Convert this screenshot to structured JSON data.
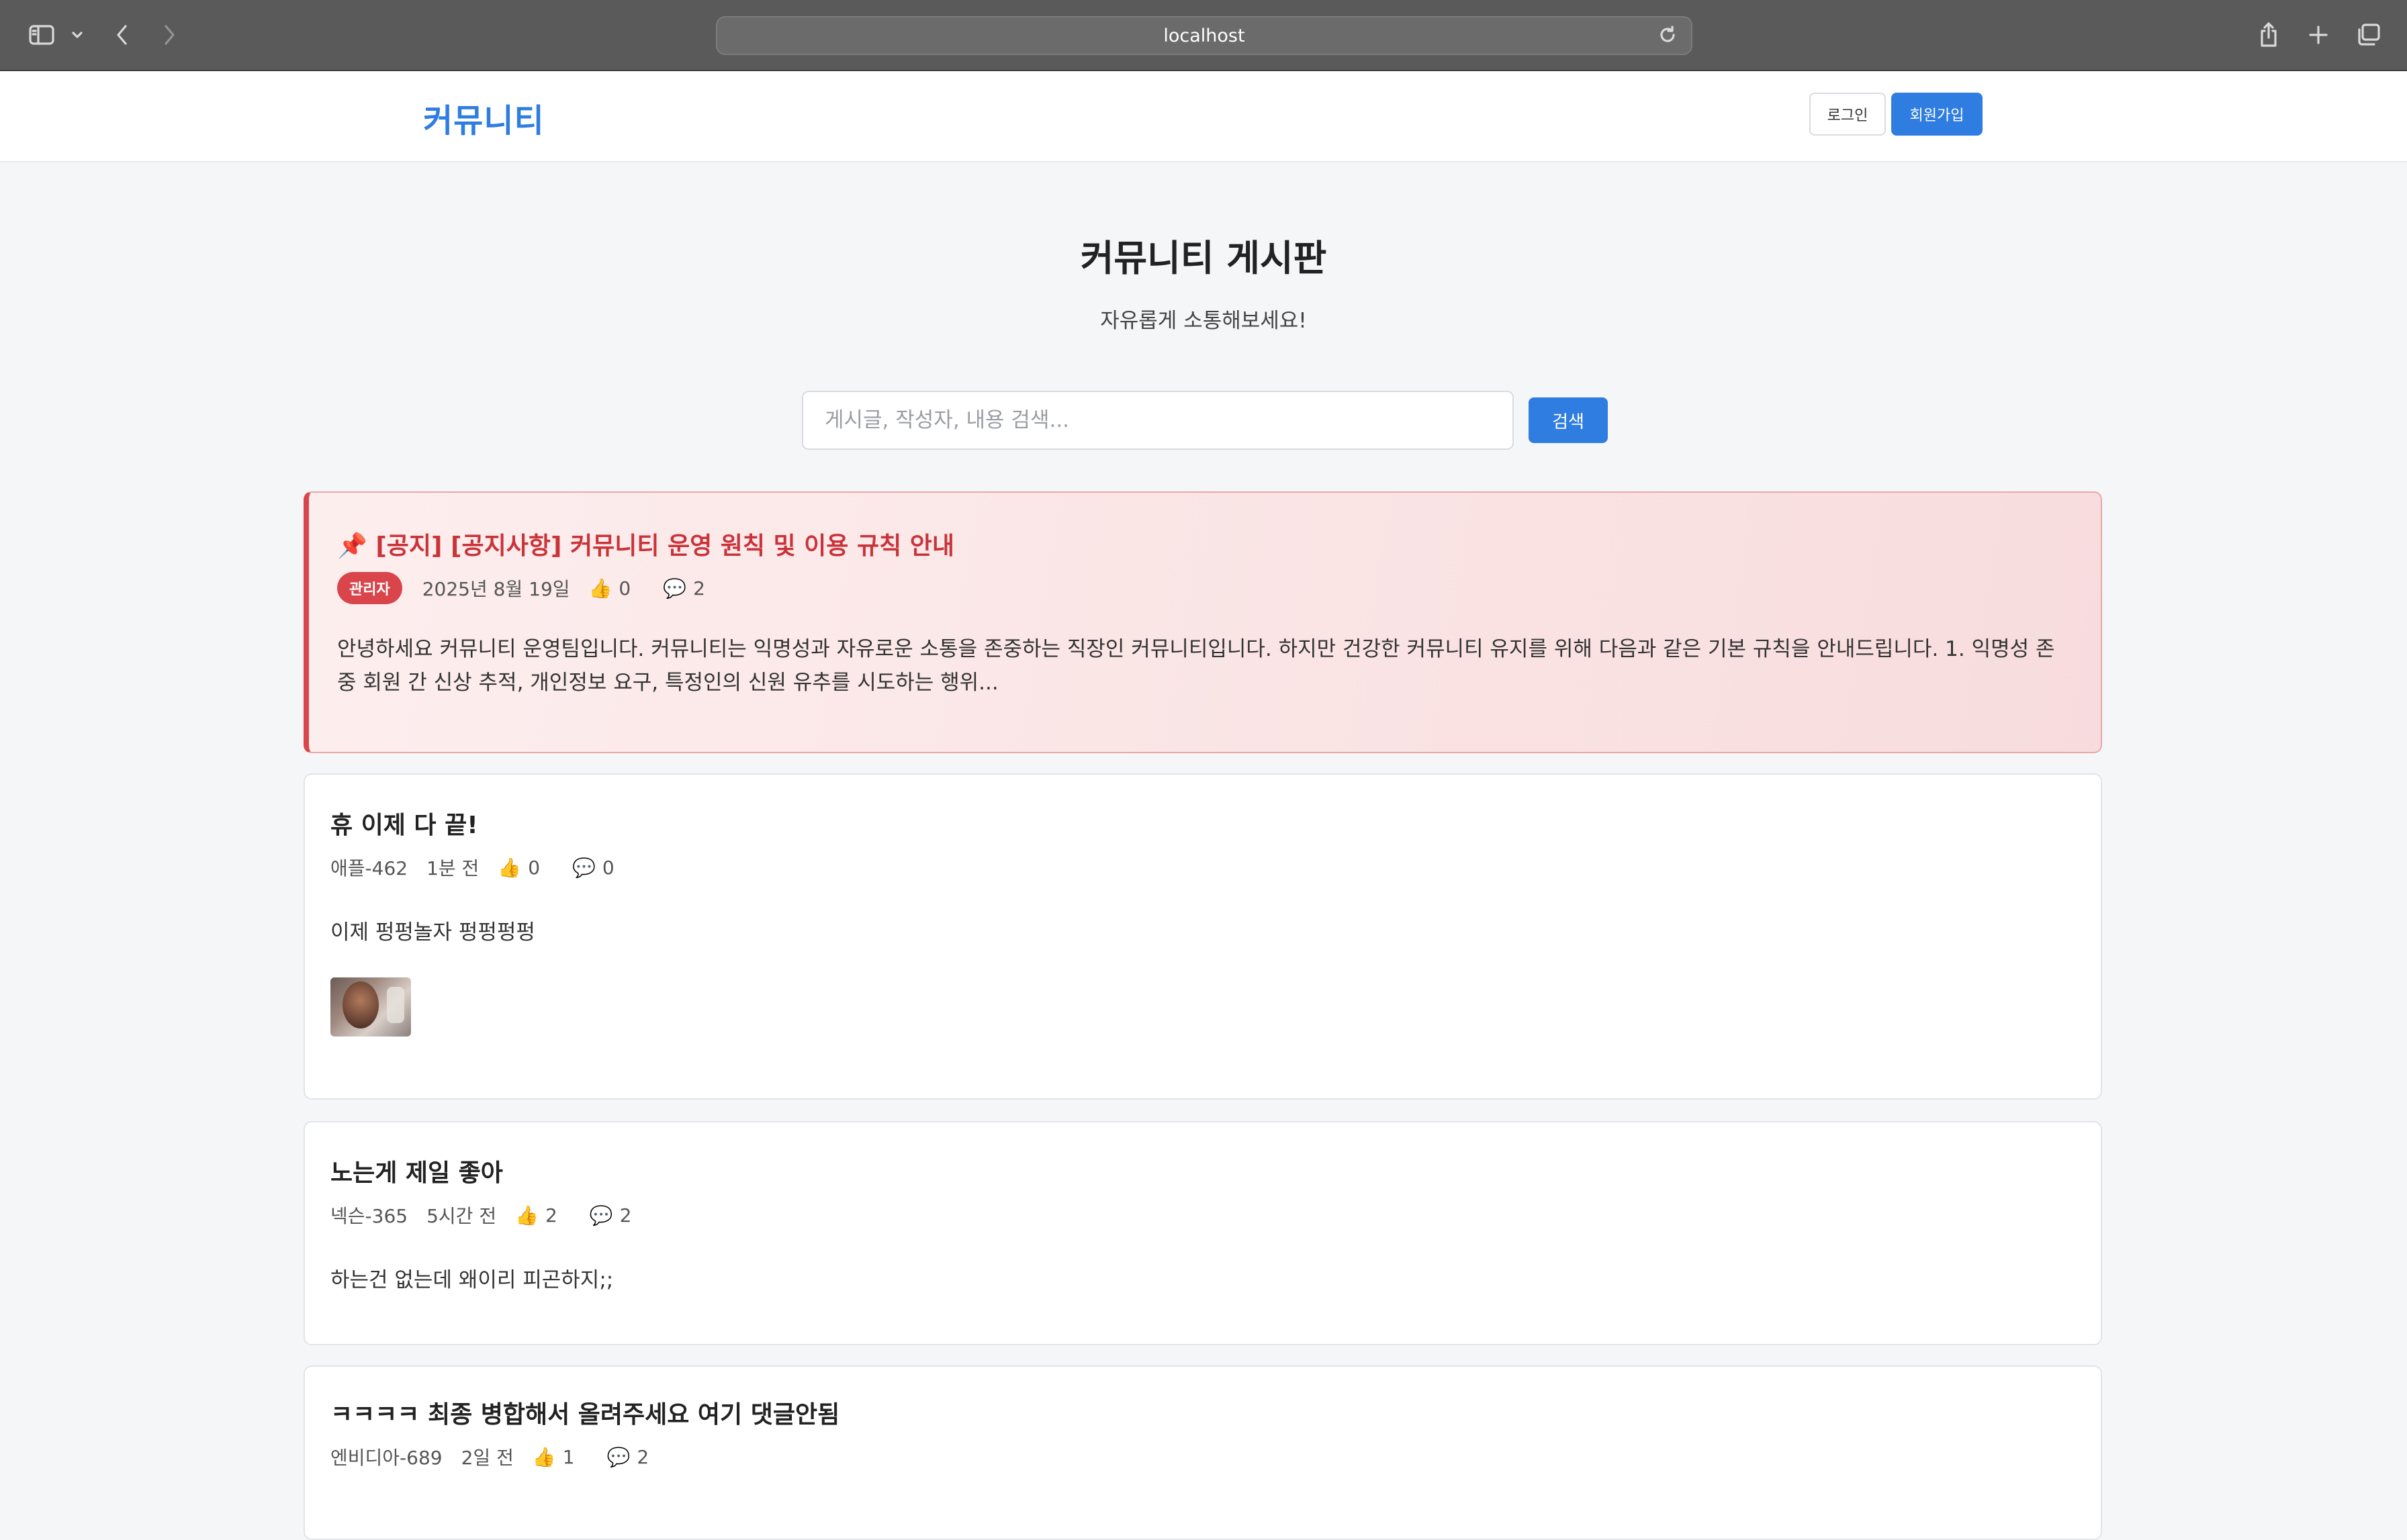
{
  "browser": {
    "url": "localhost"
  },
  "header": {
    "logo": "커뮤니티",
    "login": "로그인",
    "signup": "회원가입"
  },
  "hero": {
    "title": "커뮤니티 게시판",
    "subtitle": "자유롭게 소통해보세요!"
  },
  "search": {
    "placeholder": "게시글, 작성자, 내용 검색...",
    "button": "검색"
  },
  "notice": {
    "title": "📌 [공지] [공지사항] 커뮤니티 운영 원칙 및 이용 규칙 안내",
    "badge": "관리자",
    "date": "2025년 8월 19일",
    "likes": "0",
    "comments": "2",
    "body": "안녕하세요 커뮤니티 운영팀입니다. 커뮤니티는 익명성과 자유로운 소통을 존중하는 직장인 커뮤니티입니다. 하지만 건강한 커뮤니티 유지를 위해 다음과 같은 기본 규칙을 안내드립니다. 1. 익명성 존중 회원 간 신상 추적, 개인정보 요구, 특정인의 신원 유추를 시도하는 행위..."
  },
  "posts": [
    {
      "title": "휴 이제 다 끝!",
      "author": "애플-462",
      "time": "1분 전",
      "likes": "0",
      "comments": "0",
      "body": "이제 펑펑놀자 펑펑펑펑",
      "has_image": true
    },
    {
      "title": "노는게 제일 좋아",
      "author": "넥슨-365",
      "time": "5시간 전",
      "likes": "2",
      "comments": "2",
      "body": "하는건 없는데 왜이리 피곤하지;;"
    },
    {
      "title": "ㅋㅋㅋㅋ 최종 병합해서 올려주세요 여기 댓글안됨",
      "author": "엔비디아-689",
      "time": "2일 전",
      "likes": "1",
      "comments": "2"
    }
  ],
  "icons": {
    "like": "thumbs-up-icon",
    "comment": "speech-bubble-icon",
    "pin": "pushpin-icon"
  }
}
